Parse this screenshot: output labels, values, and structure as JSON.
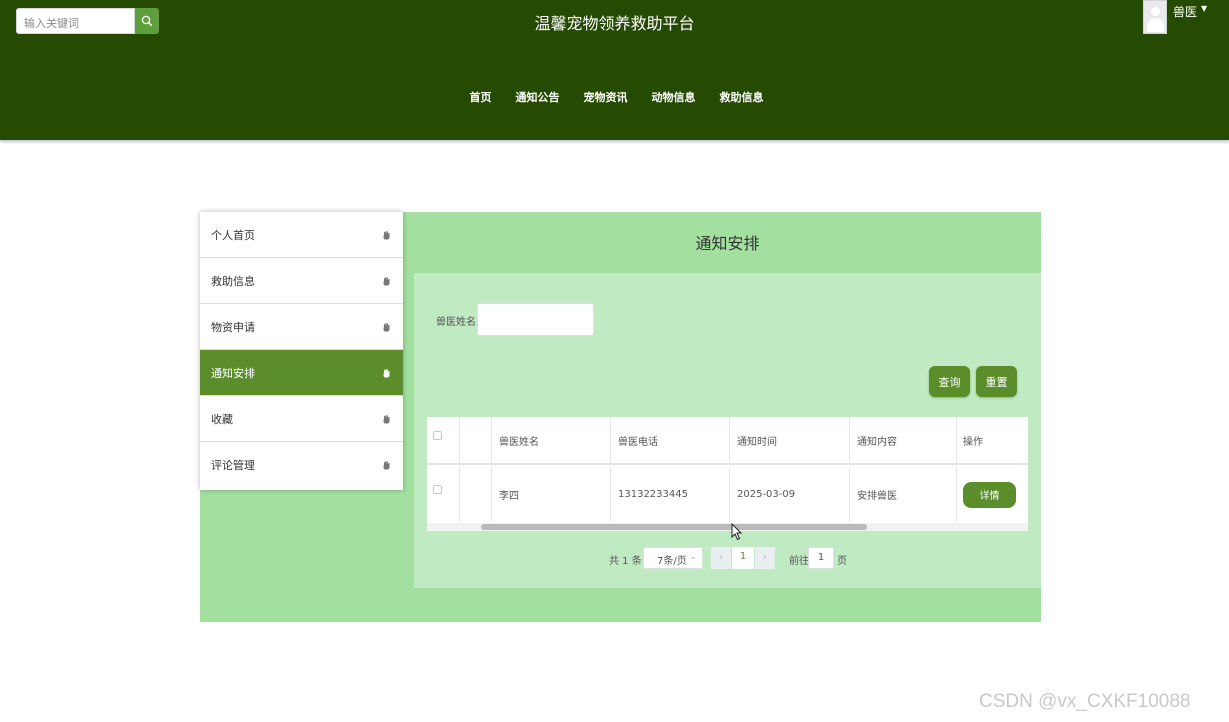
{
  "header": {
    "search_placeholder": "输入关键词",
    "title": "温馨宠物领养救助平台",
    "user_name": "兽医",
    "nav": [
      "首页",
      "通知公告",
      "宠物资讯",
      "动物信息",
      "救助信息"
    ]
  },
  "sidebar": {
    "items": [
      {
        "label": "个人首页",
        "active": false
      },
      {
        "label": "救助信息",
        "active": false
      },
      {
        "label": "物资申请",
        "active": false
      },
      {
        "label": "通知安排",
        "active": true
      },
      {
        "label": "收藏",
        "active": false
      },
      {
        "label": "评论管理",
        "active": false
      }
    ]
  },
  "content": {
    "title": "通知安排",
    "filter_label": "兽医姓名",
    "filter_value": "",
    "query_label": "查询",
    "reset_label": "重置"
  },
  "table": {
    "columns": [
      "兽医姓名",
      "兽医电话",
      "通知时间",
      "通知内容",
      "操作"
    ],
    "rows": [
      {
        "name": "李四",
        "phone": "13132233445",
        "time": "2025-03-09",
        "content": "安排兽医",
        "action": "详情"
      }
    ]
  },
  "pagination": {
    "total": "共 1 条",
    "page_size": "7条/页",
    "current_page": "1",
    "goto_label": "前往",
    "goto_value": "1",
    "page_suffix": "页"
  },
  "watermark": "CSDN @vx_CXKF10088",
  "colors": {
    "header_bg": "#254a02",
    "accent": "#5b8e2a",
    "panel_bg": "#a3e0a0",
    "content_bg": "#c0eac2"
  }
}
